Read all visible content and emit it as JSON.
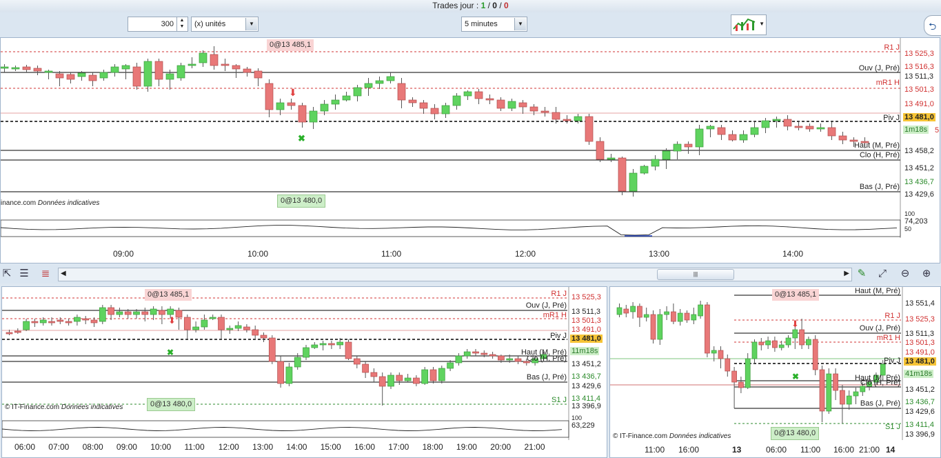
{
  "header": {
    "trades_label": "Trades jour :",
    "trades_green": "1",
    "trades_sep1": "/",
    "trades_black": "0",
    "trades_sep2": "/",
    "trades_red": "0"
  },
  "toolbar": {
    "quantity_value": "300",
    "unit_select": "(x) unités",
    "timeframe_select": "5 minutes"
  },
  "main_chart": {
    "tag_top": "0@13 485,1",
    "tag_bottom": "0@13 480,0",
    "credit_text": "inance.com",
    "credit_italic": "Données indicatives",
    "levels": {
      "r1j": "R1 J",
      "ouv": "Ouv (J, Pré)",
      "mr1h": "mR1 H",
      "piv": "Piv J",
      "haut": "Haut (M, Pré)",
      "clo": "Clo (H, Pré)",
      "bas": "Bas (J, Pré)"
    },
    "prices": [
      "13 525,3",
      "13 516,3",
      "13 511,3",
      "13 501,3",
      "13 491,0",
      "13 481,0",
      "1m18s",
      "13 458,2",
      "13 451,2",
      "13 436,7",
      "13 429,6"
    ],
    "price_badge_5": "5",
    "indicator_value": "74,203",
    "indicator_ticks": [
      "100",
      "50"
    ],
    "x_labels": [
      "09:00",
      "10:00",
      "11:00",
      "12:00",
      "13:00",
      "14:00"
    ]
  },
  "bottom_left_chart": {
    "tag_top": "0@13 485,1",
    "tag_bottom": "0@13 480,0",
    "credit_text": "© IT-Finance.com",
    "credit_italic": "Données indicatives",
    "levels": {
      "r1j": "R1 J",
      "ouv": "Ouv (J, Pré)",
      "mr1h": "mR1 H",
      "piv": "Piv J",
      "haut": "Haut (M, Pré)",
      "clo": "Clo (H, Pré)",
      "bas": "Bas (J, Pré)",
      "s1j": "S1 J"
    },
    "prices": [
      "13 525,3",
      "13 511,3",
      "13 501,3",
      "13 491,0",
      "13 481,0",
      "11m18s",
      "13 451,2",
      "13 436,7",
      "13 429,6",
      "13 411,4",
      "13 396,9"
    ],
    "indicator_value": "63,229",
    "indicator_tick": "100",
    "x_labels": [
      "06:00",
      "07:00",
      "08:00",
      "09:00",
      "10:00",
      "11:00",
      "12:00",
      "13:00",
      "14:00",
      "15:00",
      "16:00",
      "17:00",
      "18:00",
      "19:00",
      "20:00",
      "21:00"
    ]
  },
  "bottom_right_chart": {
    "tag_top": "0@13 485,1",
    "tag_bottom": "0@13 480,0",
    "credit_text": "© IT-Finance.com",
    "credit_italic": "Données indicatives",
    "levels": {
      "haut_top": "Haut (M, Pré)",
      "r1j": "R1 J",
      "ouv": "Ouv (J, Pré)",
      "mr1h": "mR1 H",
      "piv": "Piv J",
      "haut": "Haut (M, Pré)",
      "clo": "Clo (H, Pré)",
      "bas": "Bas (J, Pré)",
      "s1j": "S1 J"
    },
    "prices": [
      "13 551,4",
      "13 525,3",
      "13 511,3",
      "13 501,3",
      "13 491,0",
      "13 481,0",
      "41m18s",
      "13 451,2",
      "13 436,7",
      "13 429,6",
      "13 411,4",
      "13 396,9"
    ],
    "x_labels": [
      "11:00",
      "16:00",
      "13",
      "06:00",
      "11:00",
      "16:00",
      "21:00",
      "14"
    ]
  },
  "colors": {
    "up": "#5fd35f",
    "down": "#e87878",
    "level_red": "#d03030",
    "accent_yellow": "#f6c436"
  }
}
